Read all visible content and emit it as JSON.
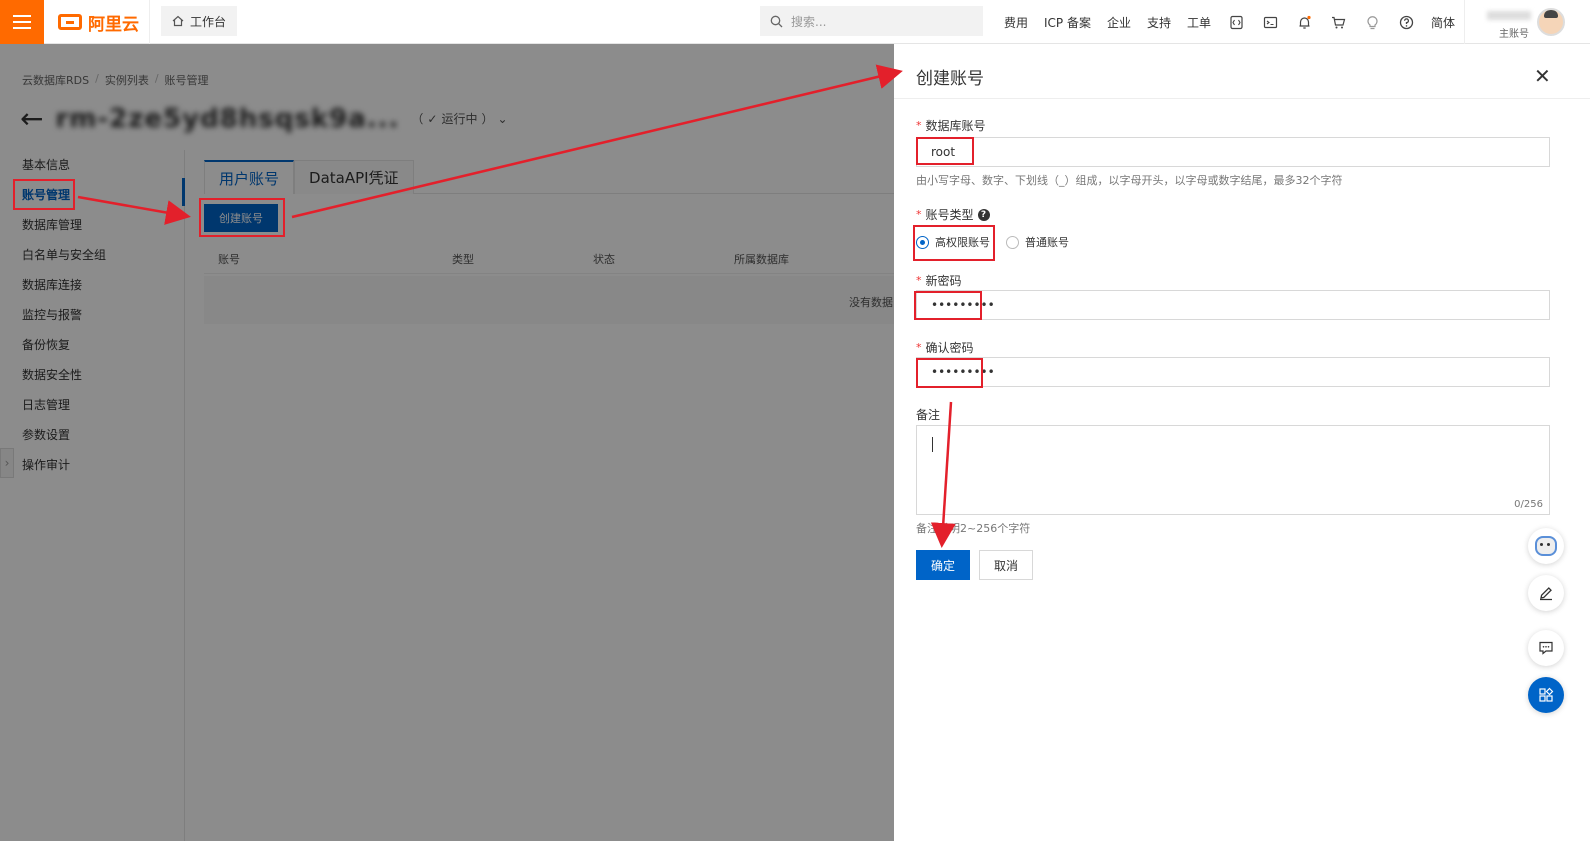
{
  "topbar": {
    "brand": "阿里云",
    "workbench": "工作台",
    "search_placeholder": "搜索...",
    "links": [
      "费用",
      "ICP 备案",
      "企业",
      "支持",
      "工单"
    ],
    "lang": "简体",
    "account_label": "主账号",
    "accent": "#ff6a00"
  },
  "page": {
    "breadcrumb": [
      "云数据库RDS",
      "实例列表",
      "账号管理"
    ],
    "instance_title": "rm-2ze5yd8hsqsk9a...",
    "instance_status": "运行中",
    "sidemenu": [
      "基本信息",
      "账号管理",
      "数据库管理",
      "白名单与安全组",
      "数据库连接",
      "监控与报警",
      "备份恢复",
      "数据安全性",
      "日志管理",
      "参数设置",
      "操作审计"
    ],
    "tabs": [
      "用户账号",
      "DataAPI凭证"
    ],
    "create_button": "创建账号",
    "table_headers": [
      "账号",
      "类型",
      "状态",
      "所属数据库"
    ],
    "empty_text": "没有数据"
  },
  "drawer": {
    "title": "创建账号",
    "account_label": "数据库账号",
    "account_value": "root",
    "account_hint": "由小写字母、数字、下划线（_）组成，以字母开头，以字母或数字结尾，最多32个字符",
    "type_label": "账号类型",
    "type_options": [
      "高权限账号",
      "普通账号"
    ],
    "type_selected": "高权限账号",
    "password_label": "新密码",
    "password_value": "•••••••••",
    "confirm_label": "确认密码",
    "confirm_value": "•••••••••",
    "remark_label": "备注",
    "remark_counter": "0/256",
    "remark_hint": "备注说明2~256个字符",
    "ok": "确定",
    "cancel": "取消",
    "primary_color": "#0064c8"
  },
  "annotation_color": "#e3202b"
}
